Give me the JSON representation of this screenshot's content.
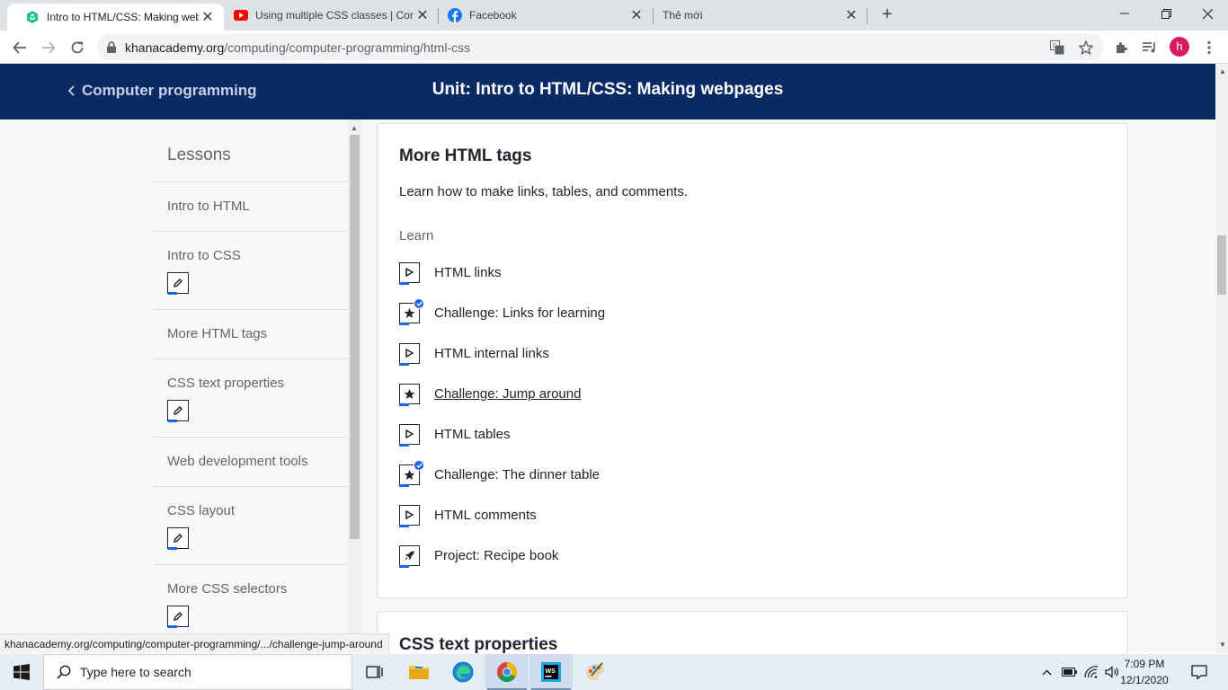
{
  "browser": {
    "tabs": [
      {
        "title": "Intro to HTML/CSS: Making webp",
        "icon": "khan-academy-icon",
        "active": true
      },
      {
        "title": "Using multiple CSS classes | Com",
        "icon": "youtube-icon",
        "active": false
      },
      {
        "title": "Facebook",
        "icon": "facebook-icon",
        "active": false
      },
      {
        "title": "Thẻ mới",
        "icon": "",
        "active": false
      }
    ],
    "new_tab": "+",
    "url_host": "khanacademy.org",
    "url_path": "/computing/computer-programming/html-css",
    "profile_initial": "h",
    "status_url": "khanacademy.org/computing/computer-programming/.../challenge-jump-around"
  },
  "header": {
    "back_label": "Computer programming",
    "unit_title": "Unit: Intro to HTML/CSS: Making webpages"
  },
  "sidebar": {
    "heading": "Lessons",
    "lessons": [
      {
        "label": "Intro to HTML",
        "has_badge": false
      },
      {
        "label": "Intro to CSS",
        "has_badge": true
      },
      {
        "label": "More HTML tags",
        "has_badge": false
      },
      {
        "label": "CSS text properties",
        "has_badge": true
      },
      {
        "label": "Web development tools",
        "has_badge": false
      },
      {
        "label": "CSS layout",
        "has_badge": true
      },
      {
        "label": "More CSS selectors",
        "has_badge": true
      }
    ]
  },
  "main": {
    "card_title": "More HTML tags",
    "card_description": "Learn how to make links, tables, and comments.",
    "section_label": "Learn",
    "items": [
      {
        "label": "HTML links",
        "icon": "play-icon",
        "completed": false
      },
      {
        "label": "Challenge: Links for learning",
        "icon": "star-icon",
        "completed": true
      },
      {
        "label": "HTML internal links",
        "icon": "play-icon",
        "completed": false
      },
      {
        "label": "Challenge: Jump around",
        "icon": "star-icon",
        "completed": false,
        "hovered": true
      },
      {
        "label": "HTML tables",
        "icon": "play-icon",
        "completed": false
      },
      {
        "label": "Challenge: The dinner table",
        "icon": "star-icon",
        "completed": true
      },
      {
        "label": "HTML comments",
        "icon": "play-icon",
        "completed": false
      },
      {
        "label": "Project: Recipe book",
        "icon": "rocket-icon",
        "completed": false
      }
    ],
    "next_card_title": "CSS text properties"
  },
  "taskbar": {
    "search_placeholder": "Type here to search",
    "time": "7:09 PM",
    "date": "12/1/2020"
  },
  "colors": {
    "header_bg": "#0a2a66",
    "accent_blue": "#1865f2",
    "page_bg": "#f7f8fa"
  }
}
